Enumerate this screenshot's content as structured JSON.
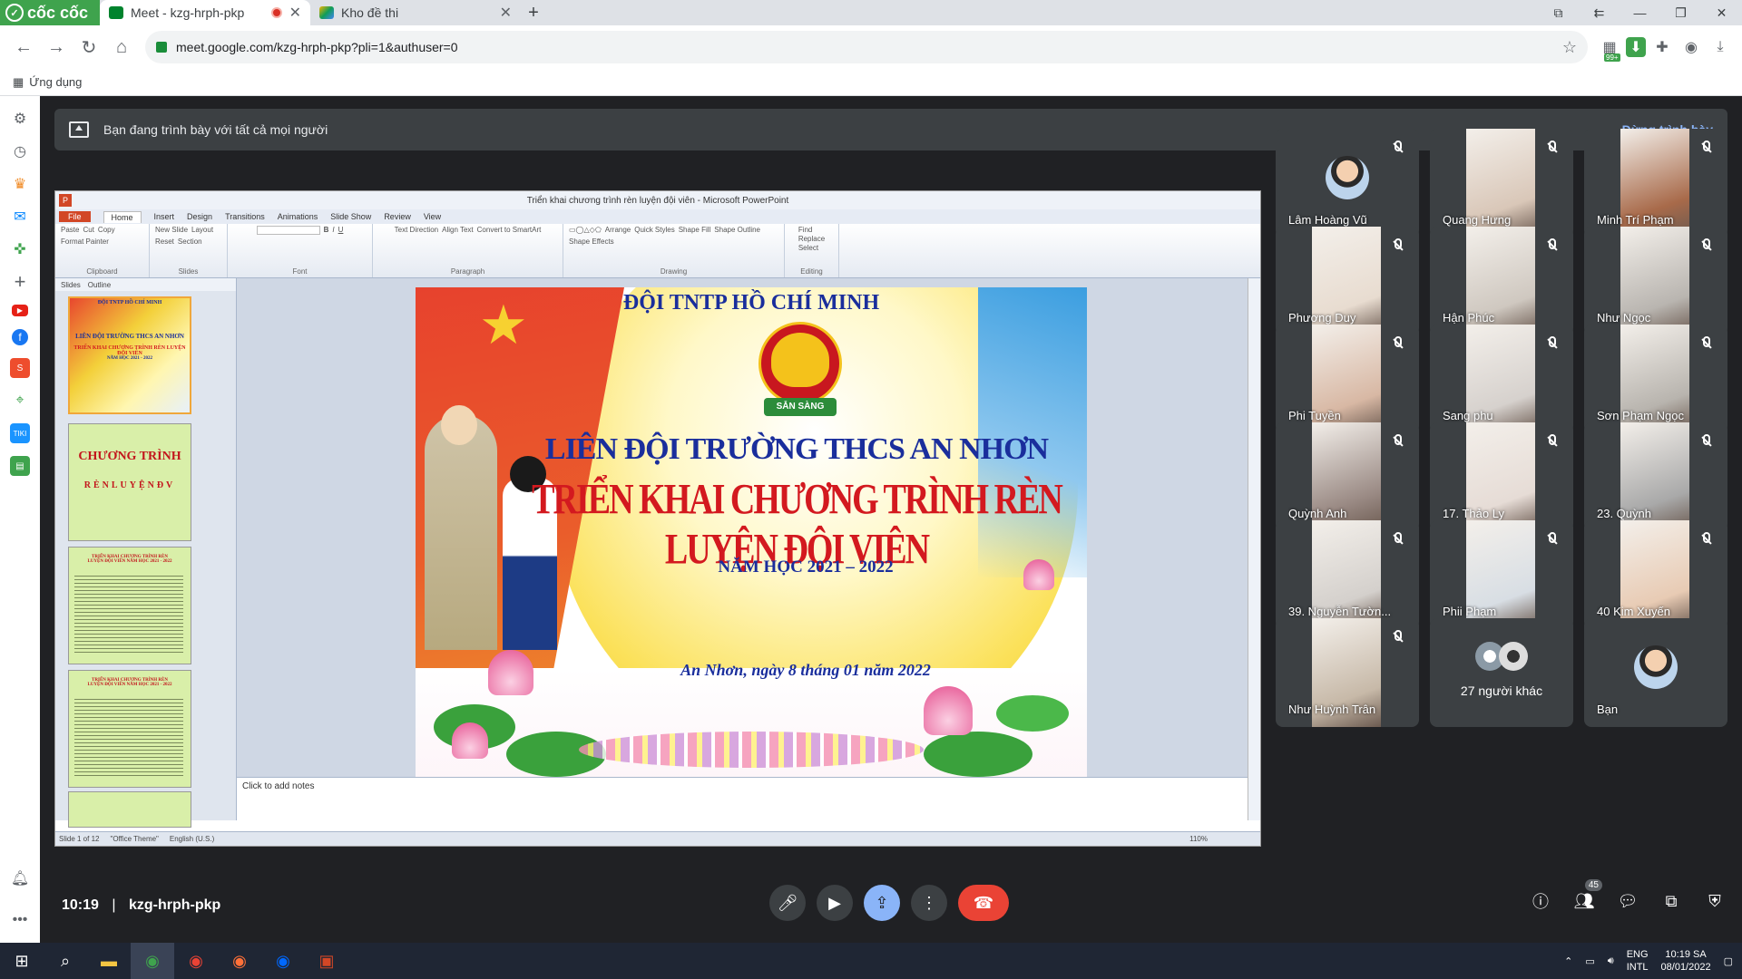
{
  "browser": {
    "brand": "cốc cốc",
    "tabs": [
      {
        "title": "Meet - kzg-hrph-pkp",
        "active": true
      },
      {
        "title": "Kho đề thi",
        "active": false
      }
    ],
    "url": "meet.google.com/kzg-hrph-pkp?pli=1&authuser=0",
    "bookmarks_label": "Ứng dụng",
    "ext_badge": "99+"
  },
  "meet": {
    "banner_text": "Bạn đang trình bày với tất cả mọi người",
    "stop_label": "Dừng trình bày",
    "time": "10:19",
    "separator": "|",
    "meeting_code": "kzg-hrph-pkp",
    "people_count": "45",
    "participants": [
      {
        "name": "Lâm Hoàng Vũ",
        "muted": true,
        "type": "avatar"
      },
      {
        "name": "Quang Hưng",
        "muted": true,
        "type": "video",
        "tone": "#d9c7b8"
      },
      {
        "name": "Minh Trí Phạm",
        "muted": true,
        "type": "video",
        "tone": "#a86a4a"
      },
      {
        "name": "Phương Duy",
        "muted": true,
        "type": "video",
        "tone": "#e8dcd0"
      },
      {
        "name": "Hận Phúc",
        "muted": true,
        "type": "video",
        "tone": "#cfc8c0"
      },
      {
        "name": "Như Ngọc",
        "muted": true,
        "type": "video",
        "tone": "#b9b5b0"
      },
      {
        "name": "Phi Tuyền",
        "muted": true,
        "type": "video",
        "tone": "#d8b8a4"
      },
      {
        "name": "Sang phu",
        "muted": true,
        "type": "video",
        "tone": "#d6d1cd"
      },
      {
        "name": "Sơn Phạm Ngọc",
        "muted": true,
        "type": "video",
        "tone": "#b8b4ae"
      },
      {
        "name": "Quỳnh Anh",
        "muted": true,
        "type": "video",
        "tone": "#9a8a84"
      },
      {
        "name": "17. Thảo Ly",
        "muted": true,
        "type": "video",
        "tone": "#e6dcd6"
      },
      {
        "name": "23. Quỳnh",
        "muted": true,
        "type": "video",
        "tone": "#a9a9a9"
      },
      {
        "name": "39. Nguyễn Tườn...",
        "muted": true,
        "type": "video",
        "tone": "#d4d0cc"
      },
      {
        "name": "Phii Phạm",
        "muted": true,
        "type": "video",
        "tone": "#d8dee4"
      },
      {
        "name": "40 Kim Xuyến",
        "muted": true,
        "type": "video",
        "tone": "#e8cbb4"
      },
      {
        "name": "Như Huỳnh Trân",
        "muted": true,
        "type": "video",
        "tone": "#c7b9a8"
      },
      {
        "name": "27 người khác",
        "muted": false,
        "type": "others"
      },
      {
        "name": "Bạn",
        "muted": false,
        "type": "avatar"
      }
    ]
  },
  "ppt": {
    "window_title": "Triển khai chương trình rèn luyện đội viên - Microsoft PowerPoint",
    "ribbon_tabs": [
      "File",
      "Home",
      "Insert",
      "Design",
      "Transitions",
      "Animations",
      "Slide Show",
      "Review",
      "View"
    ],
    "groups": [
      "Clipboard",
      "Slides",
      "Font",
      "Paragraph",
      "Drawing",
      "Editing"
    ],
    "clipboard_items": [
      "Paste",
      "Cut",
      "Copy",
      "Format Painter"
    ],
    "slides_items": [
      "New Slide",
      "Layout",
      "Reset",
      "Section"
    ],
    "drawing_items": [
      "Arrange",
      "Quick Styles",
      "Shape Fill",
      "Shape Outline",
      "Shape Effects"
    ],
    "paragraph_items": [
      "Text Direction",
      "Align Text",
      "Convert to SmartArt"
    ],
    "editing_items": [
      "Find",
      "Replace",
      "Select"
    ],
    "pane_tabs": [
      "Slides",
      "Outline"
    ],
    "notes_placeholder": "Click to add notes",
    "status": {
      "slide": "Slide 1 of 12",
      "theme": "\"Office Theme\"",
      "lang": "English (U.S.)",
      "zoom": "110%"
    },
    "thumbs": {
      "t1_line1": "ĐỘI TNTP HỒ CHÍ MINH",
      "t1_line2": "LIÊN ĐỘI TRƯỜNG THCS AN NHƠN",
      "t1_line3": "TRIỂN KHAI CHƯƠNG TRÌNH RÈN LUYỆN ĐỘI VIÊN",
      "t1_line4": "NĂM HỌC 2021 - 2022",
      "t2_title": "CHƯƠNG TRÌNH",
      "t2_letters": "RÈNLUYỆNĐV",
      "t3_title": "TRIỂN KHAI CHƯƠNG TRÌNH RÈN LUYỆN ĐỘI VIÊN NĂM HỌC 2021 - 2022"
    },
    "slide": {
      "line1": "ĐỘI TNTP HỒ CHÍ MINH",
      "badge": "SẴN SÀNG",
      "line2": "LIÊN ĐỘI TRƯỜNG THCS AN NHƠN",
      "line3": "TRIỂN KHAI CHƯƠNG TRÌNH RÈN LUYỆN ĐỘI VIÊN",
      "line4": "NĂM HỌC 2021 – 2022",
      "line5": "An Nhơn, ngày 8 tháng 01 năm 2022"
    }
  },
  "taskbar": {
    "lang1": "ENG",
    "lang2": "INTL",
    "time": "10:19 SA",
    "date": "08/01/2022"
  }
}
